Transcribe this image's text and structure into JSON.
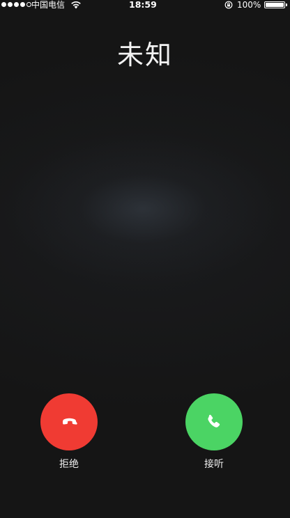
{
  "status_bar": {
    "signal_dots_filled": 4,
    "signal_dots_total": 5,
    "carrier": "中国电信",
    "time": "18:59",
    "battery_percent": "100%",
    "battery_level": 1.0,
    "icons": [
      "wifi-icon",
      "rotation-lock-icon",
      "battery-icon"
    ]
  },
  "call": {
    "caller_name": "未知",
    "decline_label": "拒绝",
    "accept_label": "接听"
  },
  "colors": {
    "background": "#151515",
    "decline": "#f03b33",
    "accept": "#4bd464",
    "text": "#ffffff"
  }
}
